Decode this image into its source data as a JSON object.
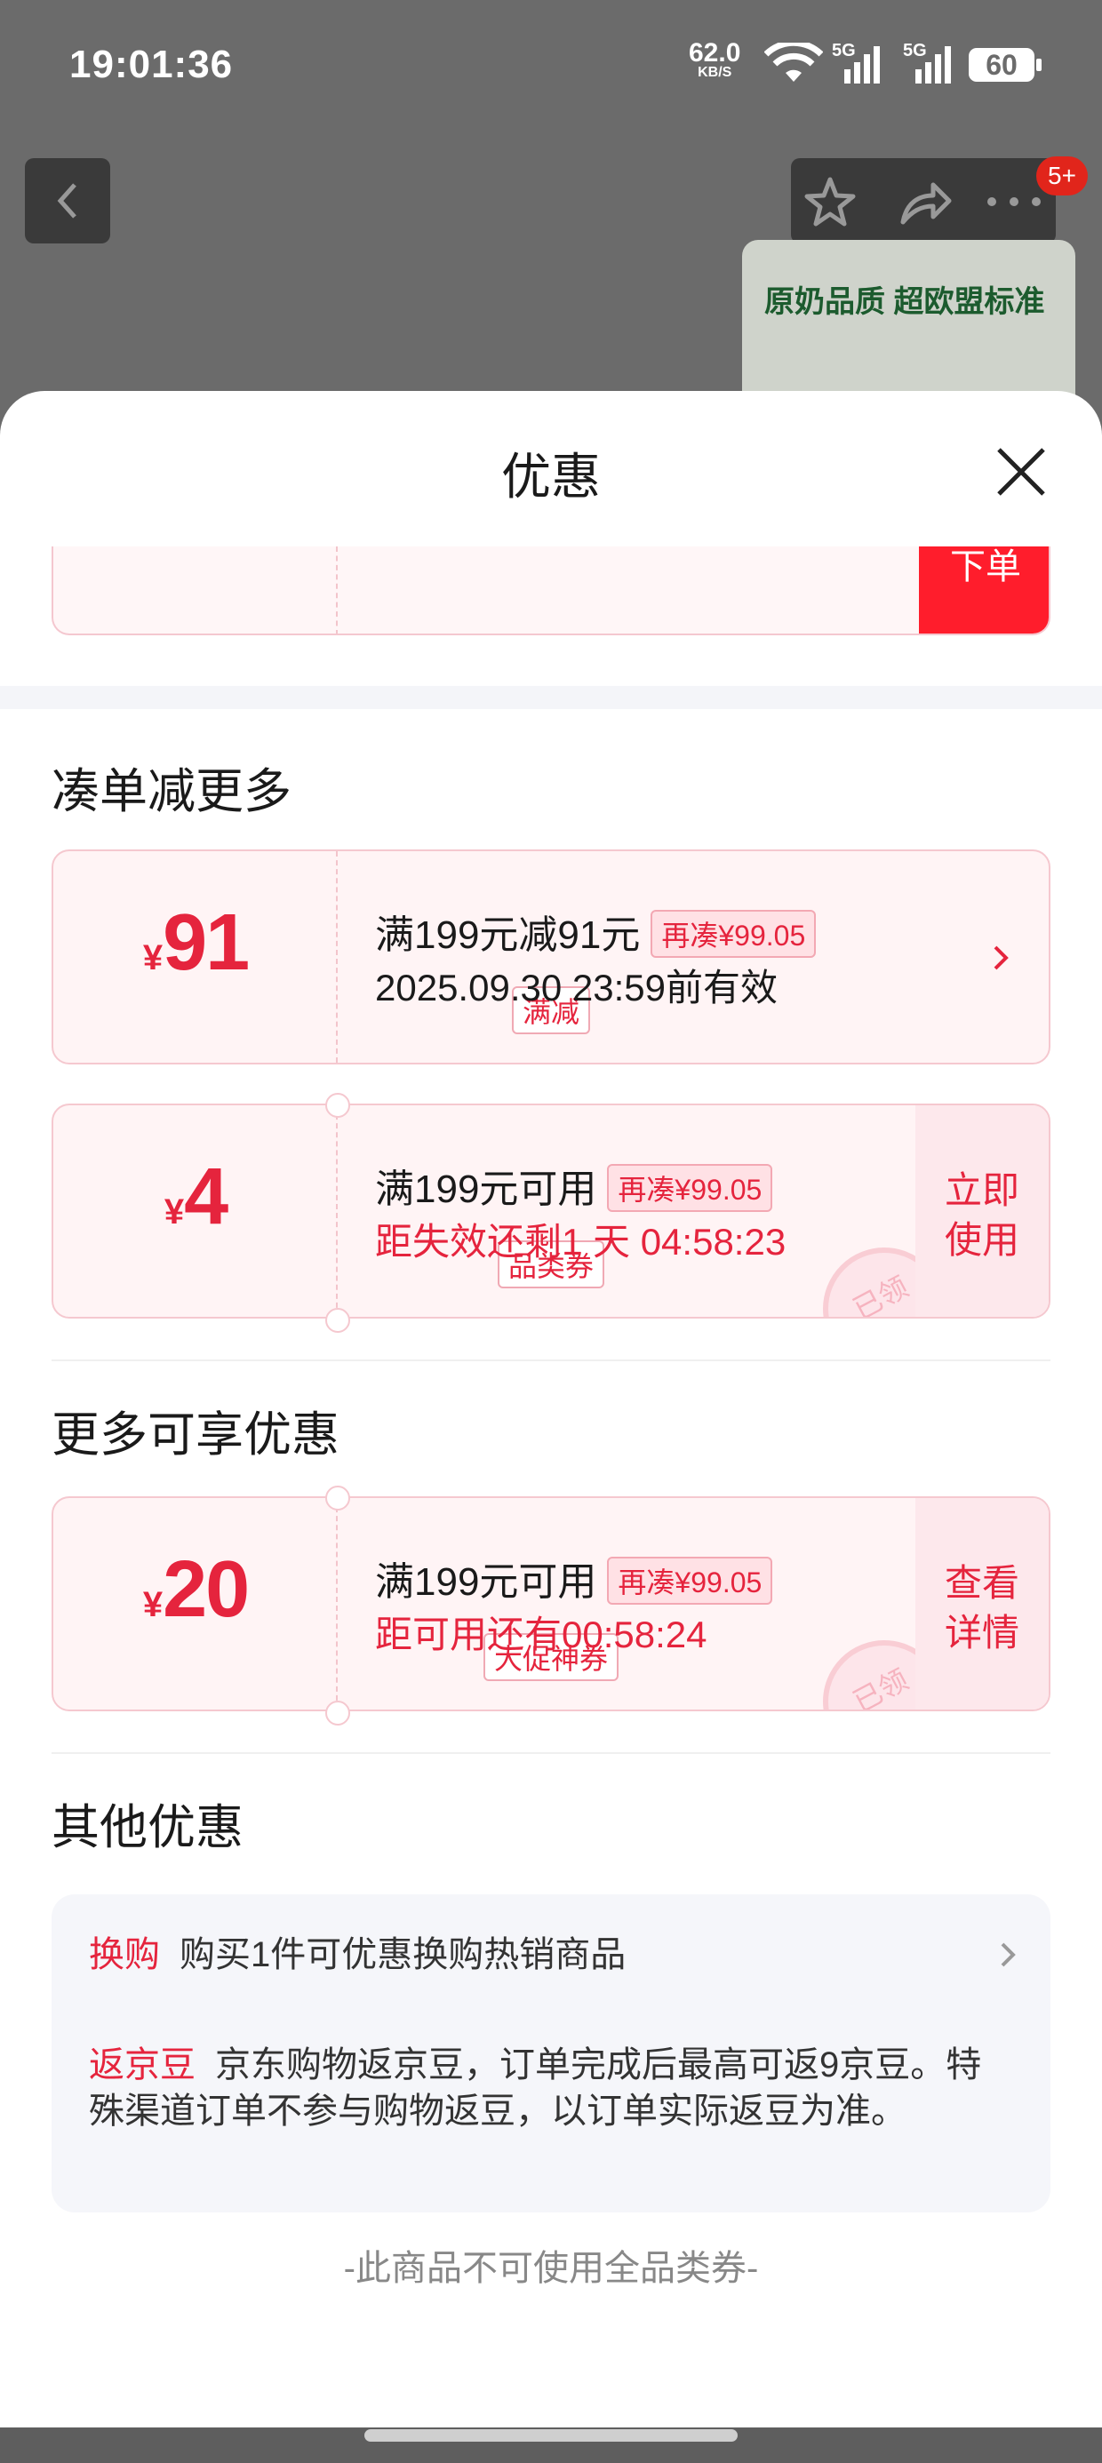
{
  "status_bar": {
    "time": "19:01:36",
    "net_speed": "62.0",
    "net_unit": "KB/S",
    "signal1": "5G",
    "signal2": "5G",
    "battery": "60"
  },
  "background_page": {
    "badge": "5+",
    "banner_text": "原奶品质 超欧盟标准"
  },
  "sheet": {
    "title": "优惠",
    "partial_top_button": "下单"
  },
  "section_more": {
    "title": "凑单减更多",
    "cards": [
      {
        "currency": "¥",
        "amount": "91",
        "tag": "满减",
        "line1": "满199元减91元",
        "pill": "再凑¥99.05",
        "line2": "2025.09.30 23:59前有效"
      },
      {
        "currency": "¥",
        "amount": "4",
        "tag": "品类券",
        "line1": "满199元可用",
        "pill": "再凑¥99.05",
        "line2": "距失效还剩1 天 04:58:23",
        "button_line1": "立即",
        "button_line2": "使用",
        "stamp": "已领"
      }
    ]
  },
  "section_enjoy": {
    "title": "更多可享优惠",
    "cards": [
      {
        "currency": "¥",
        "amount": "20",
        "tag": "大促神券",
        "line1": "满199元可用",
        "pill": "再凑¥99.05",
        "line2": "距可用还有00:58:24",
        "button_line1": "查看",
        "button_line2": "详情",
        "stamp": "已领"
      }
    ]
  },
  "section_other": {
    "title": "其他优惠",
    "rows": [
      {
        "label": "换购",
        "text": "购买1件可优惠换购热销商品"
      },
      {
        "label": "返京豆",
        "text": "京东购物返京豆，订单完成后最高可返9京豆。特殊渠道订单不参与购物返豆，以订单实际返豆为准。"
      }
    ]
  },
  "footer_note": "-此商品不可使用全品类券-"
}
